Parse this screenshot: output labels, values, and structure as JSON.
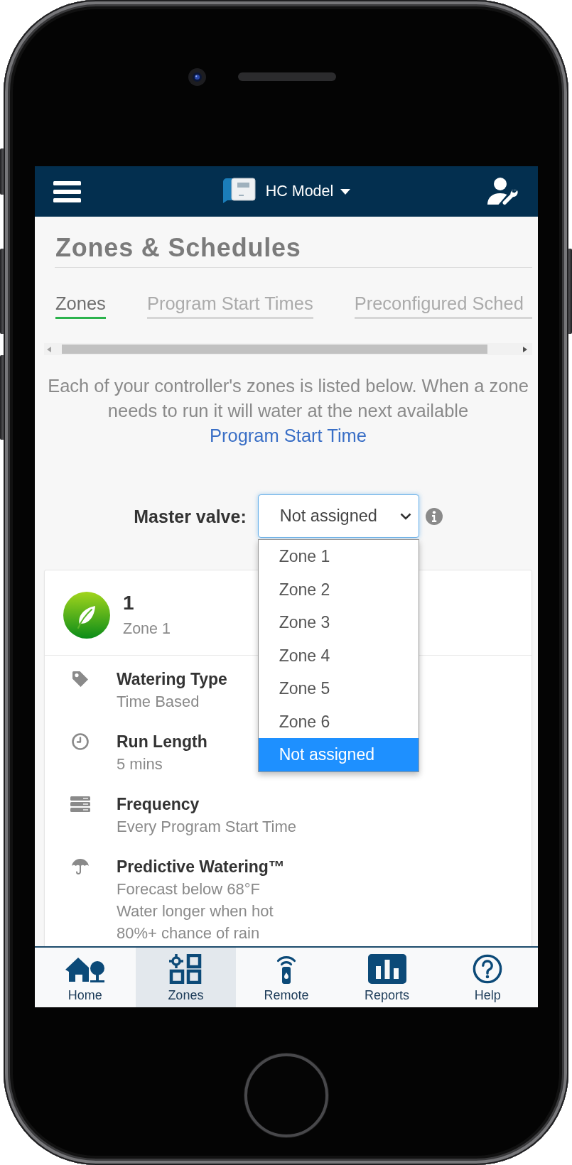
{
  "header": {
    "device_name": "HC Model"
  },
  "page_title": "Zones & Schedules",
  "tabs": [
    {
      "label": "Zones",
      "selected": true
    },
    {
      "label": "Program Start Times",
      "selected": false
    },
    {
      "label": "Preconfigured Sched",
      "selected": false
    }
  ],
  "description": {
    "text": "Each of your controller's zones is listed below. When a zone needs to run it will water at the next available",
    "link": "Program Start Time"
  },
  "master_valve": {
    "label": "Master valve:",
    "value": "Not assigned",
    "expanded": true,
    "options": [
      {
        "label": "Zone 1",
        "selected": false
      },
      {
        "label": "Zone 2",
        "selected": false
      },
      {
        "label": "Zone 3",
        "selected": false
      },
      {
        "label": "Zone 4",
        "selected": false
      },
      {
        "label": "Zone 5",
        "selected": false
      },
      {
        "label": "Zone 6",
        "selected": false
      },
      {
        "label": "Not assigned",
        "selected": true
      }
    ]
  },
  "zone": {
    "number": "1",
    "name": "Zone 1",
    "details": [
      {
        "kind": "tag",
        "title": "Watering Type",
        "lines": [
          "Time Based"
        ]
      },
      {
        "kind": "clock",
        "title": "Run Length",
        "lines": [
          "5 mins"
        ]
      },
      {
        "kind": "frequency",
        "title": "Frequency",
        "lines": [
          "Every Program Start Time"
        ]
      },
      {
        "kind": "umbrella",
        "title": "Predictive Watering™",
        "lines": [
          "Forecast below 68°F",
          "Water longer when hot",
          "80%+ chance of rain"
        ]
      }
    ]
  },
  "bottom_nav": [
    {
      "kind": "home",
      "label": "Home",
      "selected": false
    },
    {
      "kind": "zones",
      "label": "Zones",
      "selected": true
    },
    {
      "kind": "remote",
      "label": "Remote",
      "selected": false
    },
    {
      "kind": "reports",
      "label": "Reports",
      "selected": false
    },
    {
      "kind": "help",
      "label": "Help",
      "selected": false
    }
  ]
}
